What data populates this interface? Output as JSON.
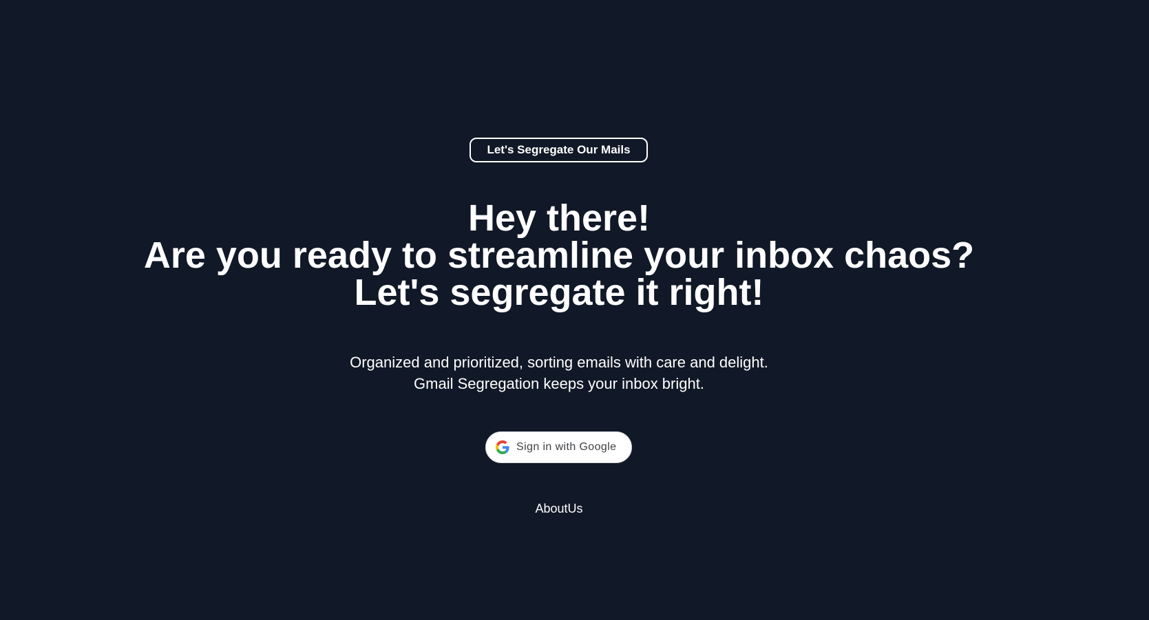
{
  "badge": {
    "label": "Let's Segregate Our Mails"
  },
  "hero": {
    "line1": "Hey there!",
    "line2": "Are you ready to streamline your inbox chaos?",
    "line3": "Let's segregate it right!"
  },
  "tagline": {
    "line1": "Organized and prioritized, sorting emails with care and delight.",
    "line2": "Gmail Segregation keeps your inbox bright."
  },
  "signin": {
    "label": "Sign in with Google",
    "icon": "google-g-icon"
  },
  "footer": {
    "about_label": "AboutUs"
  },
  "colors": {
    "background": "#111827",
    "text": "#ffffff",
    "button_bg": "#ffffff",
    "button_text": "#3c4043"
  }
}
